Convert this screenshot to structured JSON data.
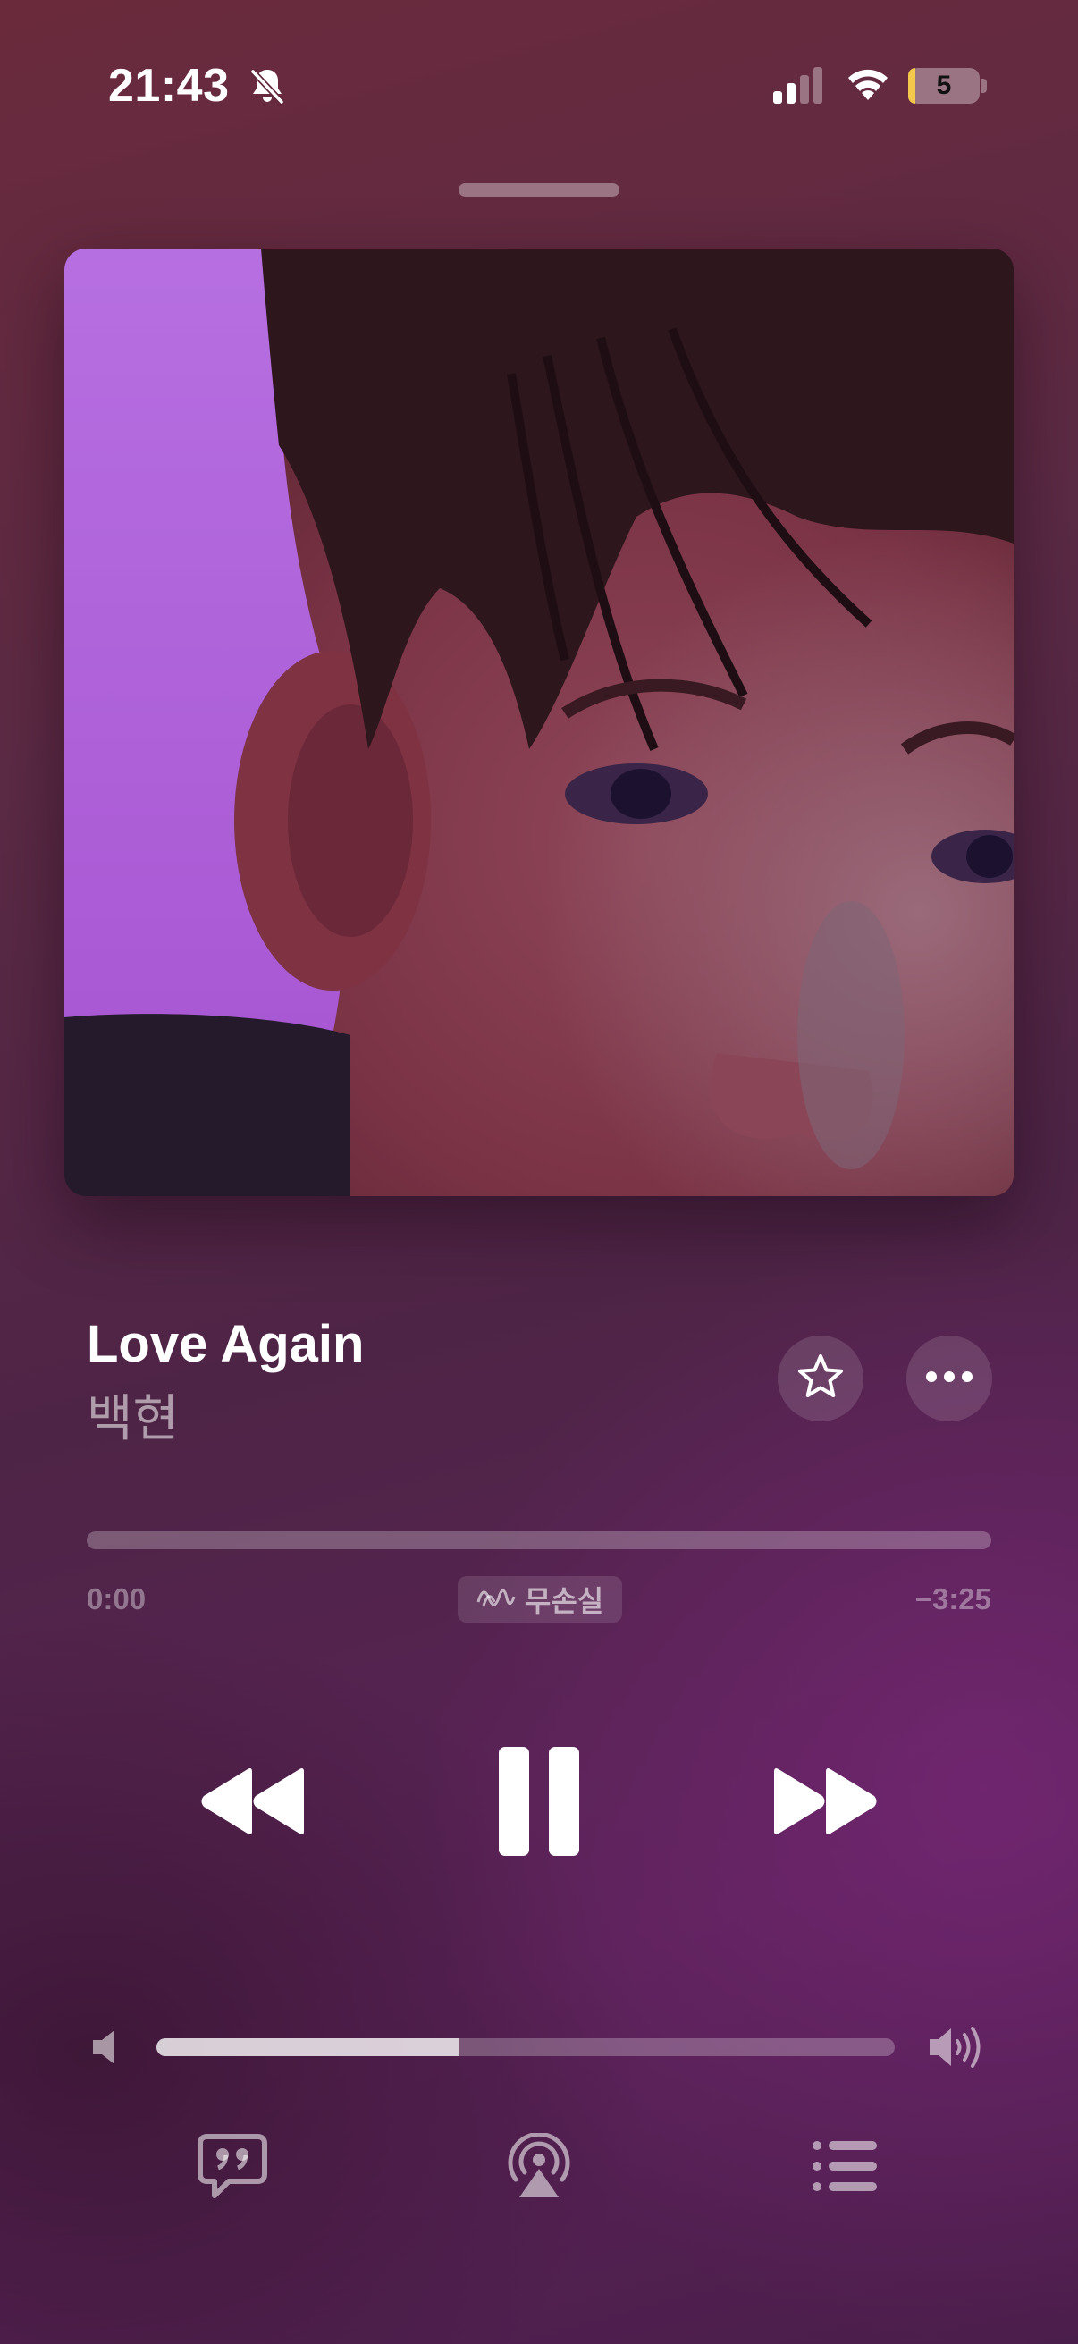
{
  "status_bar": {
    "time": "21:43",
    "battery_level": "5",
    "icons": [
      "bell-slash-icon",
      "cellular-signal-icon",
      "wifi-icon",
      "battery-icon"
    ]
  },
  "now_playing": {
    "title": "Love Again",
    "artist": "백현",
    "elapsed": "0:00",
    "remaining": "−3:25",
    "progress_fraction": 0.0,
    "quality_badge": "무손실",
    "is_playing": true,
    "volume_fraction": 0.41
  },
  "colors": {
    "accent": "#ffffff",
    "background_top": "#6a2a3c",
    "background_bottom": "#5a2258"
  },
  "icons": {
    "favorite": "star-icon",
    "more": "ellipsis-icon",
    "rewind": "rewind-icon",
    "pause": "pause-icon",
    "forward": "fast-forward-icon",
    "volume_low": "speaker-low-icon",
    "volume_high": "speaker-high-icon",
    "lyrics": "lyrics-quote-bubble-icon",
    "airplay": "airplay-audio-icon",
    "queue": "queue-list-icon"
  }
}
